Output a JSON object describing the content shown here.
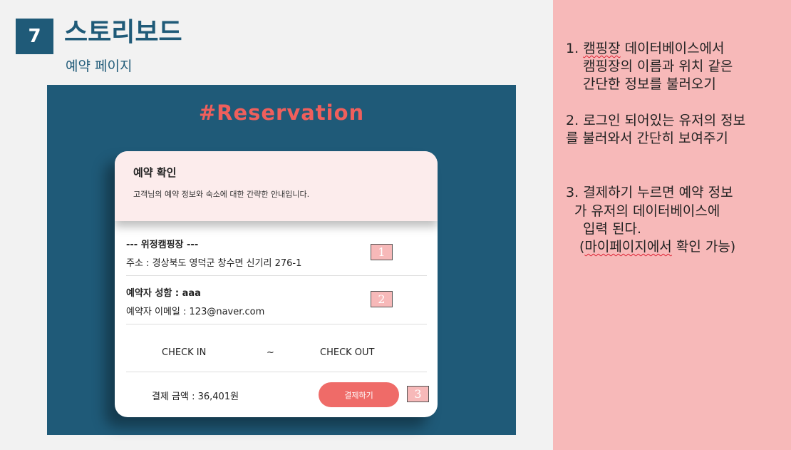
{
  "slide": {
    "number": "7",
    "title": "스토리보드",
    "subtitle": "예약 페이지"
  },
  "mockup": {
    "heading": "#Reservation",
    "card": {
      "title": "예약 확인",
      "description": "고객님의 예약 정보와 숙소에 대한 간략한 안내입니다.",
      "campsite_name": "--- 위정캠핑장 ---",
      "address": "주소 : 경상북도 영덕군 창수면 신기리 276-1",
      "reserver_name": "예약자 성함 : aaa",
      "reserver_email": "예약자 이메일 : 123@naver.com",
      "check_in": "CHECK IN",
      "separator": "~",
      "check_out": "CHECK OUT",
      "payment_amount": "결제 금액 : 36,401원",
      "pay_button": "결제하기"
    },
    "tags": [
      "1",
      "2",
      "3"
    ]
  },
  "notes": {
    "n1": {
      "prefix": "1.",
      "squiggle_word": "캠핑장",
      "line1_rest": " 데이터베이스에서",
      "line2": "캠핑장의 이름과 위치 같은",
      "line3": "간단한 정보를 불러오기"
    },
    "n2": {
      "prefix": "2.",
      "line1_rest": "로그인 되어있는 유저의 정보",
      "line2": "를 불러와서 간단히 보여주기"
    },
    "n3": {
      "prefix": "3.",
      "line1_rest": "결제하기 누르면 예약 정보",
      "line2": "가 유저의 데이터베이스에",
      "line3": "입력 된다.",
      "line4_open": "(",
      "line4_squiggle": "마이페이지에서",
      "line4_rest": " 확인 가능)"
    }
  },
  "colors": {
    "accent": "#1f5a78",
    "heading": "#ef5f5c",
    "pink_panel": "#f7b9b9",
    "button": "#ef6b68"
  }
}
